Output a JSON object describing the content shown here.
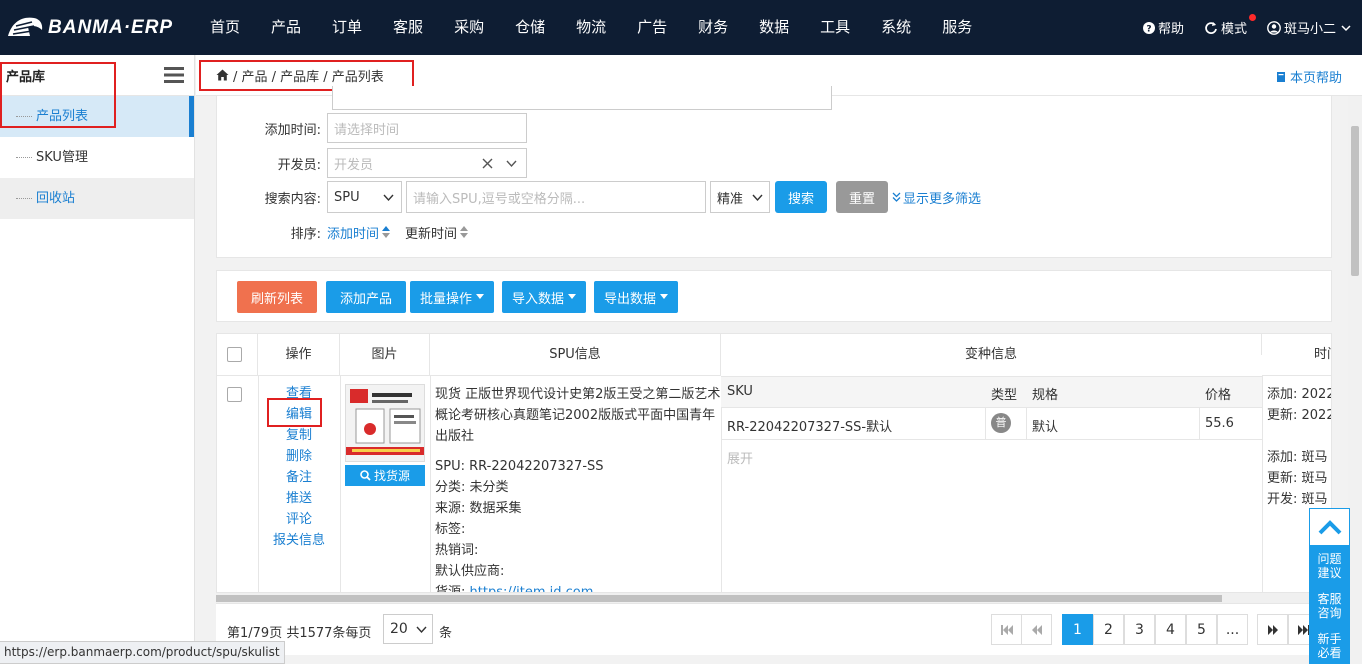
{
  "topbar": {
    "logo_text": "BANMA·ERP",
    "nav": [
      "首页",
      "产品",
      "订单",
      "客服",
      "采购",
      "仓储",
      "物流",
      "广告",
      "财务",
      "数据",
      "工具",
      "系统",
      "服务"
    ],
    "help": "帮助",
    "mode": "模式",
    "user": "斑马小二"
  },
  "sidebar": {
    "title": "产品库",
    "items": [
      {
        "label": "产品列表"
      },
      {
        "label": "SKU管理"
      },
      {
        "label": "回收站"
      }
    ]
  },
  "breadcrumb": {
    "text": "/ 产品 / 产品库 / 产品列表",
    "page_help": "本页帮助"
  },
  "filters": {
    "add_time_label": "添加时间:",
    "add_time_placeholder": "请选择时间",
    "developer_label": "开发员:",
    "developer_placeholder": "开发员",
    "search_label": "搜索内容:",
    "search_type": "SPU",
    "search_placeholder": "请输入SPU,逗号或空格分隔...",
    "match_mode": "精准",
    "search_button": "搜索",
    "reset_button": "重置",
    "more_filters": "显示更多筛选",
    "sort_label": "排序:",
    "sort_add_time": "添加时间",
    "sort_update_time": "更新时间"
  },
  "toolbar": {
    "refresh": "刷新列表",
    "add_product": "添加产品",
    "batch_ops": "批量操作",
    "import": "导入数据",
    "export": "导出数据"
  },
  "table": {
    "headers": {
      "ops": "操作",
      "image": "图片",
      "spu": "SPU信息",
      "variant": "变种信息",
      "time": "时间"
    },
    "variant_headers": {
      "sku": "SKU",
      "type": "类型",
      "spec": "规格",
      "price": "价格"
    },
    "row": {
      "ops": [
        "查看",
        "编辑",
        "复制",
        "删除",
        "备注",
        "推送",
        "评论",
        "报关信息"
      ],
      "find_source": "找货源",
      "title": "现货 正版世界现代设计史第2版王受之第二版艺术概论考研核心真题笔记2002版版式平面中国青年出版社",
      "spu_line": "SPU:  RR-22042207327-SS",
      "category_line": "分类:  未分类",
      "source_line": "来源:  数据采集",
      "tags_line": "标签:",
      "hotwords_line": "热销词:",
      "supplier_line": "默认供应商:",
      "goods_source_label": "货源:",
      "goods_source_link": "https://item.jd.com",
      "variant": {
        "sku": "RR-22042207327-SS-默认",
        "type": "普",
        "spec": "默认",
        "price": "55.6"
      },
      "expand": "展开",
      "time_lines": [
        "添加: 2022",
        "更新: 2022",
        "添加: 斑马",
        "更新: 斑马",
        "开发: 斑马"
      ]
    }
  },
  "pagination": {
    "summary": "第1/79页 共1577条每页",
    "page_size": "20",
    "unit": "条",
    "pages": [
      "1",
      "2",
      "3",
      "4",
      "5",
      "..."
    ]
  },
  "float_panel": {
    "items": [
      "问题建议",
      "客服咨询",
      "新手必看"
    ]
  },
  "status_url": "https://erp.banmaerp.com/product/spu/skulist",
  "colors": {
    "topbar": "#0e1d33",
    "primary": "#1a7fd1",
    "button_blue": "#1a9ce8",
    "refresh_orange": "#f0714e",
    "highlight_red": "#e02020"
  }
}
